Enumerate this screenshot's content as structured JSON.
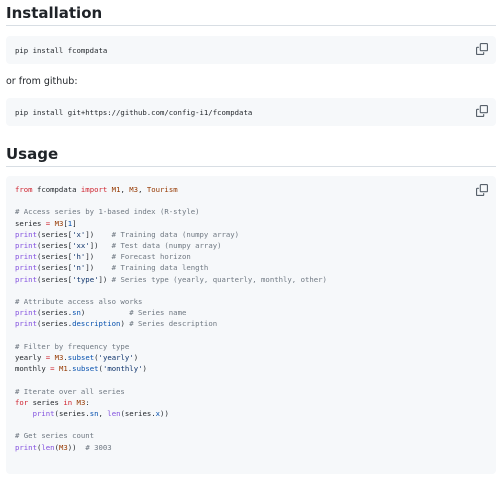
{
  "installation": {
    "heading": "Installation",
    "pip_command": "pip install fcompdata",
    "github_intro": "or from github:",
    "github_command": "pip install git+https://github.com/config-i1/fcompdata"
  },
  "usage": {
    "heading": "Usage",
    "code_lines": {
      "l1": {
        "a": "from",
        "b": " fcompdata ",
        "c": "import",
        "d": " ",
        "e": "M1",
        "f": ", ",
        "g": "M3",
        "h": ", ",
        "i": "Tourism"
      },
      "l3": "# Access series by 1-based index (R-style)",
      "l4": {
        "a": "series ",
        "b": "=",
        "c": " ",
        "d": "M3",
        "e": "[",
        "f": "1",
        "g": "]"
      },
      "l5": {
        "a": "print",
        "b": "(series[",
        "c": "'x'",
        "d": "])    ",
        "e": "# Training data (numpy array)"
      },
      "l6": {
        "a": "print",
        "b": "(series[",
        "c": "'xx'",
        "d": "])   ",
        "e": "# Test data (numpy array)"
      },
      "l7": {
        "a": "print",
        "b": "(series[",
        "c": "'h'",
        "d": "])    ",
        "e": "# Forecast horizon"
      },
      "l8": {
        "a": "print",
        "b": "(series[",
        "c": "'n'",
        "d": "])    ",
        "e": "# Training data length"
      },
      "l9": {
        "a": "print",
        "b": "(series[",
        "c": "'type'",
        "d": "]) ",
        "e": "# Series type (yearly, quarterly, monthly, other)"
      },
      "l11": "# Attribute access also works",
      "l12": {
        "a": "print",
        "b": "(series.",
        "c": "sn",
        "d": ")          ",
        "e": "# Series name"
      },
      "l13": {
        "a": "print",
        "b": "(series.",
        "c": "description",
        "d": ") ",
        "e": "# Series description"
      },
      "l15": "# Filter by frequency type",
      "l16": {
        "a": "yearly ",
        "b": "=",
        "c": " ",
        "d": "M3",
        "e": ".",
        "f": "subset",
        "g": "(",
        "h": "'yearly'",
        "i": ")"
      },
      "l17": {
        "a": "monthly ",
        "b": "=",
        "c": " ",
        "d": "M1",
        "e": ".",
        "f": "subset",
        "g": "(",
        "h": "'monthly'",
        "i": ")"
      },
      "l19": "# Iterate over all series",
      "l20": {
        "a": "for",
        "b": " series ",
        "c": "in",
        "d": " ",
        "e": "M3",
        "f": ":"
      },
      "l21": {
        "a": "    ",
        "b": "print",
        "c": "(series.",
        "d": "sn",
        "e": ", ",
        "f": "len",
        "g": "(series.",
        "h": "x",
        "i": "))"
      },
      "l23": "# Get series count",
      "l24": {
        "a": "print",
        "b": "(",
        "c": "len",
        "d": "(",
        "e": "M3",
        "f": "))  ",
        "g": "# 3003"
      }
    }
  },
  "icons": {
    "copy": "copy-icon"
  }
}
